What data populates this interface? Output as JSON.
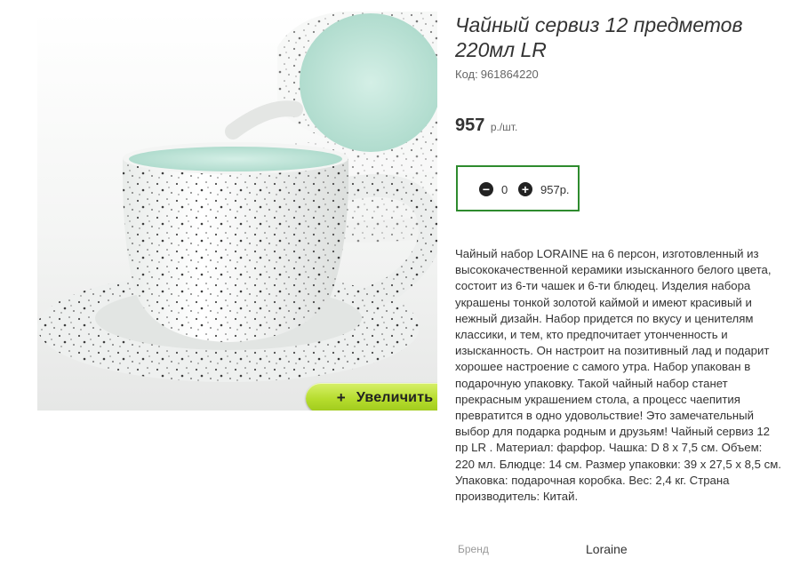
{
  "product": {
    "title": "Чайный сервиз 12 предметов 220мл LR",
    "sku_label": "Код:",
    "sku": "961864220",
    "price": "957",
    "price_unit": "р./шт.",
    "zoom_label": "Увеличить",
    "zoom_plus": "+"
  },
  "cart": {
    "minus": "−",
    "quantity": "0",
    "plus": "+",
    "total": "957р."
  },
  "description": "Чайный набор LORAINE на 6 персон, изготовленный из высококачественной керамики изысканного белого цвета, состоит из 6-ти чашек и 6-ти блюдец. Изделия набора украшены тонкой золотой каймой и имеют красивый и нежный дизайн. Набор придется по вкусу и ценителям классики, и тем, кто предпочитает утонченность и изысканность. Он настроит на позитивный лад и подарит хорошее настроение с самого утра. Набор упакован в подарочную упаковку. Такой чайный набор станет прекрасным украшением стола, а процесс чаепития превратится в одно удовольствие! Это замечательный выбор для подарка родным и друзьям! Чайный сервиз 12 пр LR . Материал: фарфор. Чашка: D 8 х 7,5 см. Объем: 220 мл. Блюдце: 14 см. Размер упаковки: 39 х 27,5 х 8,5 см. Упаковка: подарочная коробка. Вес: 2,4 кг. Страна производитель: Китай.",
  "attributes": {
    "brand_label": "Бренд",
    "brand_value": "Loraine"
  },
  "colors": {
    "accent_border": "#2e8b2e",
    "zoom_button": "#b5dc2c",
    "cup_inner": "#bfe3d6"
  }
}
